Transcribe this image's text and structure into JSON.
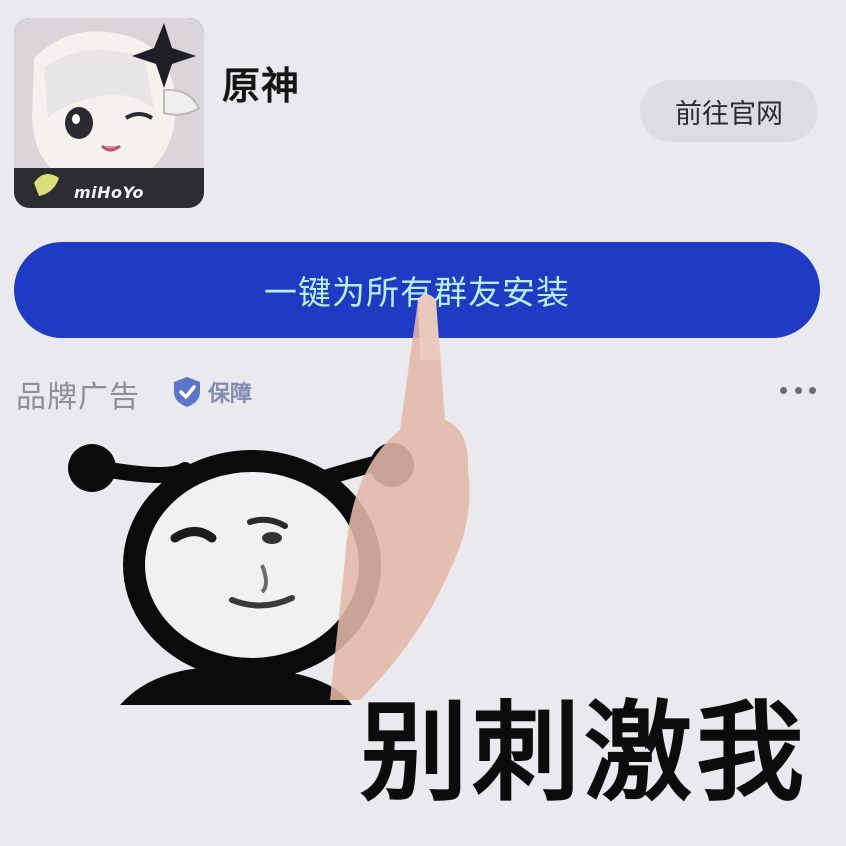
{
  "app": {
    "icon_name": "genshin-app-icon",
    "icon_label": "miHoYo",
    "title": "原神"
  },
  "header": {
    "official_site_label": "前往官网"
  },
  "install": {
    "label": "一键为所有群友安装"
  },
  "ad": {
    "label": "品牌广告",
    "badge_label": "保障",
    "badge_icon": "shield-check-icon",
    "more_icon": "more-dots-icon"
  },
  "meme": {
    "caption": "别刺激我"
  },
  "colors": {
    "background": "#e9e9ee",
    "install_button": "#1f3bc4",
    "install_text": "#b6f0e9",
    "site_button": "#dcdde3"
  }
}
